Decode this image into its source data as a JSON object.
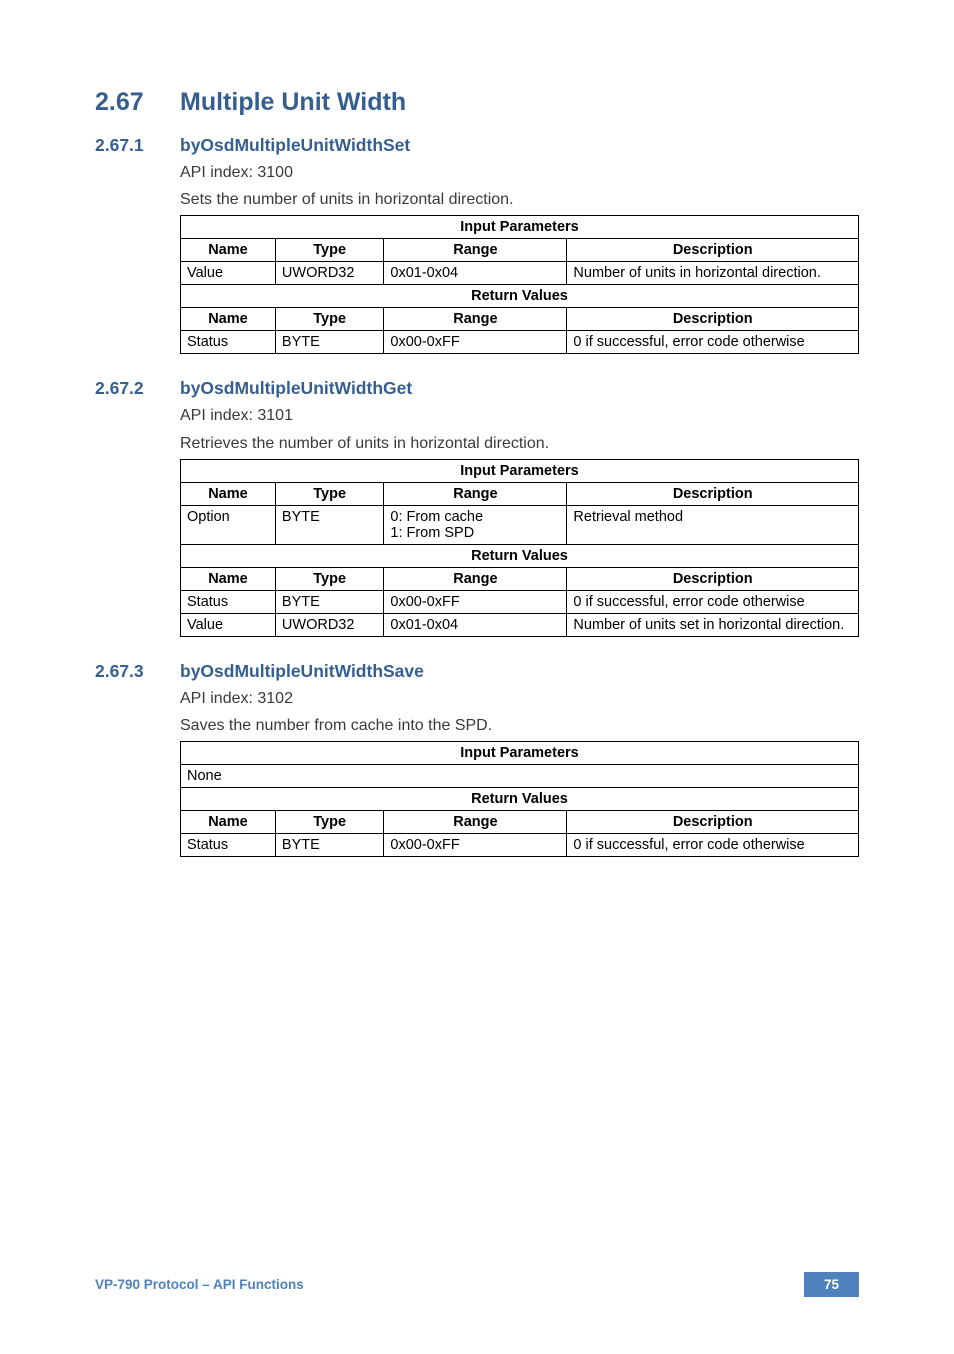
{
  "h1": {
    "num": "2.67",
    "title": "Multiple Unit Width"
  },
  "sec1": {
    "num": "2.67.1",
    "title": "byOsdMultipleUnitWidthSet",
    "api": "API index: 3100",
    "desc": "Sets the number of units in horizontal direction.",
    "input_header": "Input Parameters",
    "return_header": "Return Values",
    "cols": {
      "name": "Name",
      "type": "Type",
      "range": "Range",
      "desc": "Description"
    },
    "row1": {
      "name": "Value",
      "type": "UWORD32",
      "range": "0x01-0x04",
      "desc": "Number of units in horizontal direction."
    },
    "row2": {
      "name": "Status",
      "type": "BYTE",
      "range": "0x00-0xFF",
      "desc": "0 if successful, error code otherwise"
    }
  },
  "sec2": {
    "num": "2.67.2",
    "title": "byOsdMultipleUnitWidthGet",
    "api": "API index: 3101",
    "desc": "Retrieves the number of units in horizontal direction.",
    "input_header": "Input Parameters",
    "return_header": "Return Values",
    "cols": {
      "name": "Name",
      "type": "Type",
      "range": "Range",
      "desc": "Description"
    },
    "row1": {
      "name": "Option",
      "type": "BYTE",
      "range": "0: From cache\n1: From SPD",
      "desc": "Retrieval method"
    },
    "row2": {
      "name": "Status",
      "type": "BYTE",
      "range": "0x00-0xFF",
      "desc": "0 if successful, error code otherwise"
    },
    "row3": {
      "name": "Value",
      "type": "UWORD32",
      "range": "0x01-0x04",
      "desc": "Number of units set in horizontal direction."
    }
  },
  "sec3": {
    "num": "2.67.3",
    "title": "byOsdMultipleUnitWidthSave",
    "api": "API index: 3102",
    "desc": "Saves the number from cache into the SPD.",
    "input_header": "Input Parameters",
    "return_header": "Return Values",
    "none": "None",
    "cols": {
      "name": "Name",
      "type": "Type",
      "range": "Range",
      "desc": "Description"
    },
    "row1": {
      "name": "Status",
      "type": "BYTE",
      "range": "0x00-0xFF",
      "desc": "0 if successful, error code otherwise"
    }
  },
  "footer": {
    "text": "VP-790 Protocol –  API Functions",
    "page": "75"
  }
}
